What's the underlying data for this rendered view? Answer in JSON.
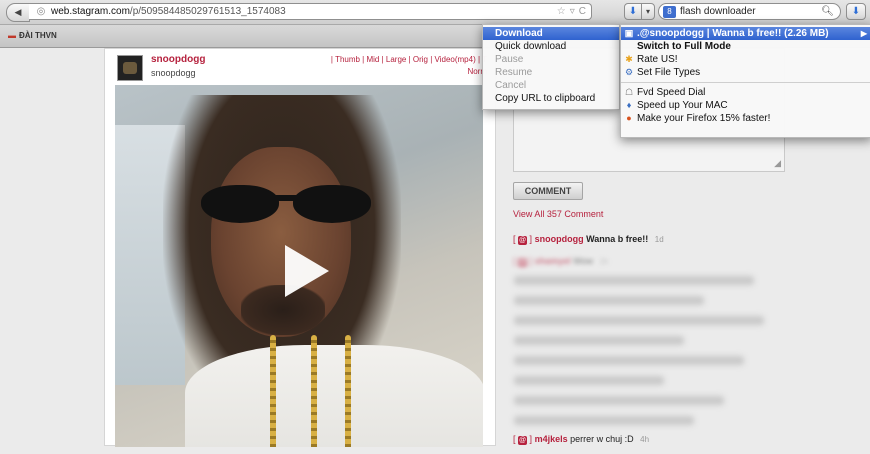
{
  "browser": {
    "url_host": "web.stagram.com",
    "url_path": "/p/509584485029761513_1574083",
    "search_text": "flash downloader",
    "bookmark": "ĐÀI THVN"
  },
  "post": {
    "username": "snoopdogg",
    "username_sub": "snoopdogg",
    "size_links": "| Thumb | Mid | Large | Orig | Video(mp4) | T",
    "normal_link": "Norm"
  },
  "comments": {
    "button_label": "COMMENT",
    "view_all": "View All 357 Comment",
    "first": {
      "user": "snoopdogg",
      "message": "Wanna b free!!",
      "time": "1d"
    },
    "second": {
      "user": "shamyel",
      "message": "Wow",
      "time": "1h"
    },
    "last": {
      "user": "m4jkels",
      "message": "perrer w chuj :D",
      "time": "4h"
    }
  },
  "menu1": {
    "items": [
      "Download",
      "Quick download",
      "Pause",
      "Resume",
      "Cancel",
      "Copy URL to clipboard"
    ]
  },
  "menu2": {
    "video_item": ".@snoopdogg | Wanna b free!! (2.26 MB)",
    "full_mode": "Switch to Full Mode",
    "rate": "Rate US!",
    "file_types": "Set File Types",
    "speed_dial": "Fvd Speed Dial",
    "speed_mac": "Speed up Your MAC",
    "firefox": "Make your Firefox 15% faster!"
  },
  "colors": {
    "accent": "#b6223e",
    "menu_highlight": "#2f62cf"
  }
}
